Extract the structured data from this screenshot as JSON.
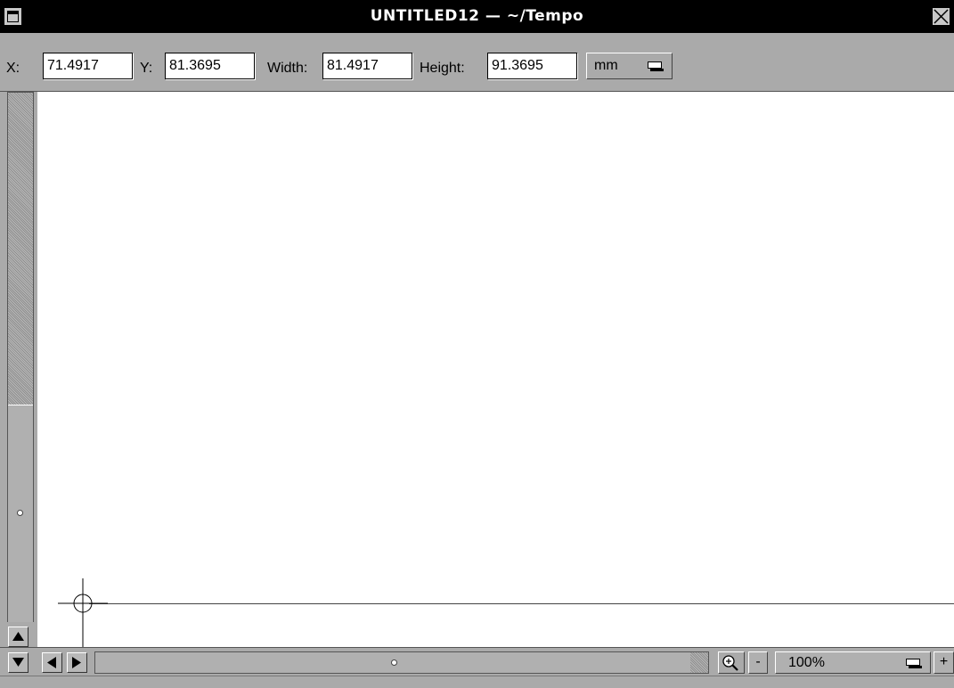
{
  "window": {
    "title": "UNTITLED12 — ~/Tempo"
  },
  "geometry": {
    "x_label": "X:",
    "x_value": "71.4917",
    "y_label": "Y:",
    "y_value": "81.3695",
    "width_label": "Width:",
    "width_value": "81.4917",
    "height_label": "Height:",
    "height_value": "91.3695",
    "unit": "mm"
  },
  "bottom": {
    "zoom_out_label": "-",
    "zoom_value": "100%",
    "zoom_in_label": "+"
  },
  "icons": {
    "title_left": "window-menu-icon",
    "title_right": "close-icon",
    "zoom": "magnifier-icon",
    "crosshair": "crosshair-icon"
  }
}
